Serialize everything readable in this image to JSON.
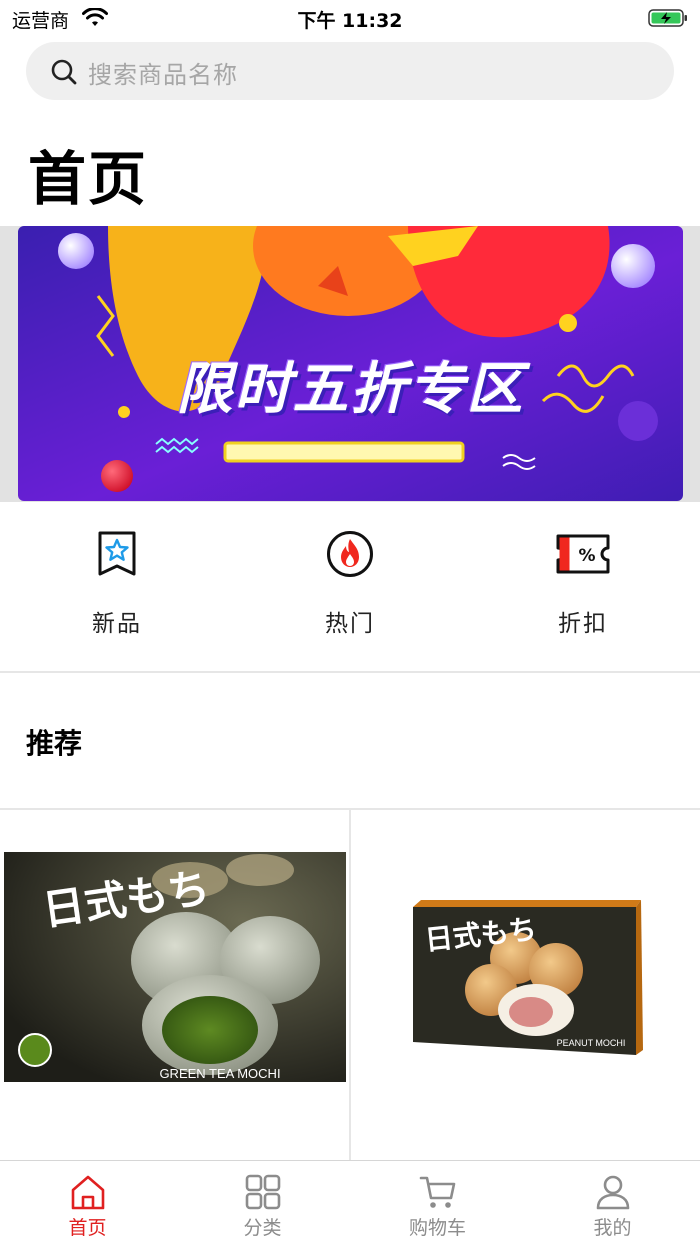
{
  "status_bar": {
    "carrier": "运营商",
    "time": "下午 11:32"
  },
  "search": {
    "placeholder": "搜索商品名称"
  },
  "page_title": "首页",
  "banner": {
    "text": "限时五折专区"
  },
  "shortcuts": [
    {
      "label": "新品",
      "icon": "new-product-bookmark-star-icon"
    },
    {
      "label": "热门",
      "icon": "hot-flame-icon"
    },
    {
      "label": "折扣",
      "icon": "discount-ticket-icon"
    }
  ],
  "section": {
    "title": "推荐"
  },
  "products": [
    {
      "image": "green-tea-mochi-box",
      "box_title": "日式もち",
      "box_caption": "GREEN TEA MOCHI"
    },
    {
      "image": "peanut-mochi-box",
      "box_title": "日式もち",
      "box_caption": "PEANUT MOCHI"
    }
  ],
  "tab_bar": {
    "items": [
      {
        "label": "首页",
        "icon": "home-icon",
        "active": true
      },
      {
        "label": "分类",
        "icon": "category-grid-icon",
        "active": false
      },
      {
        "label": "购物车",
        "icon": "cart-icon",
        "active": false
      },
      {
        "label": "我的",
        "icon": "user-icon",
        "active": false
      }
    ]
  },
  "colors": {
    "accent": "#e02020",
    "search_bg": "#efefef",
    "banner_bg": "#5a1cc7"
  }
}
